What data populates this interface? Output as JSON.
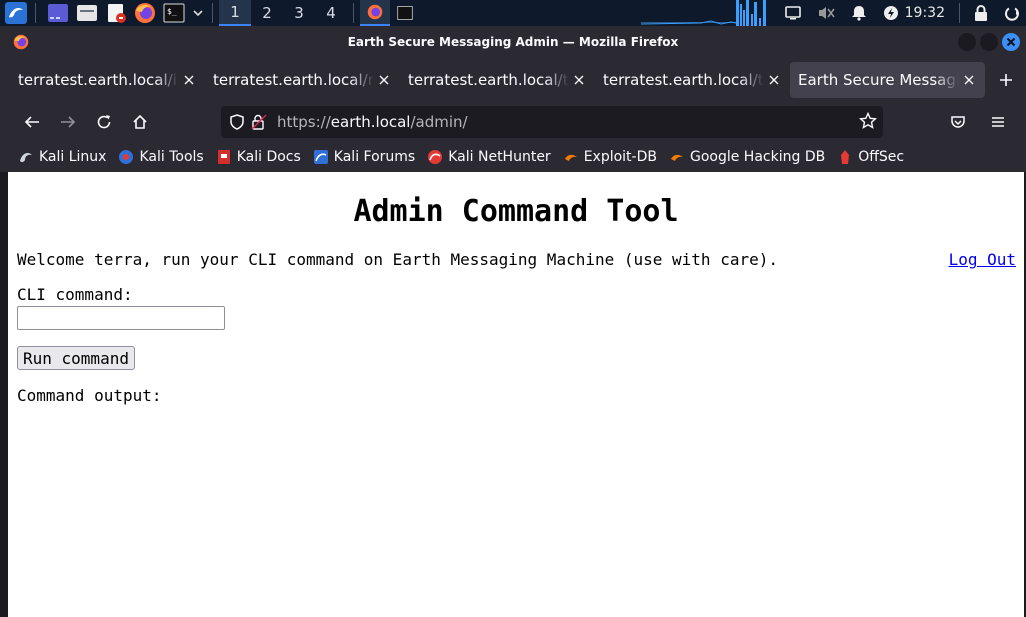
{
  "taskbar": {
    "workspaces": [
      "1",
      "2",
      "3",
      "4"
    ],
    "active_workspace": "1",
    "clock": "19:32",
    "accent": "#3b82f6"
  },
  "window": {
    "title": "Earth Secure Messaging Admin — Mozilla Firefox"
  },
  "tabs": [
    {
      "label": "terratest.earth.local/index",
      "active": false
    },
    {
      "label": "terratest.earth.local/robots",
      "active": false
    },
    {
      "label": "terratest.earth.local/testingnotes",
      "active": false
    },
    {
      "label": "terratest.earth.local/testdata",
      "active": false
    },
    {
      "label": "Earth Secure Messaging Admin",
      "active": true
    }
  ],
  "urlbar": {
    "scheme": "https://",
    "host": "earth.local",
    "path": "/admin/"
  },
  "bookmarks": [
    {
      "label": "Kali Linux",
      "icon": "kali-dragon-icon"
    },
    {
      "label": "Kali Tools",
      "icon": "kali-tools-icon"
    },
    {
      "label": "Kali Docs",
      "icon": "kali-docs-icon"
    },
    {
      "label": "Kali Forums",
      "icon": "kali-forums-icon"
    },
    {
      "label": "Kali NetHunter",
      "icon": "kali-nethunter-icon"
    },
    {
      "label": "Exploit-DB",
      "icon": "exploit-db-icon"
    },
    {
      "label": "Google Hacking DB",
      "icon": "ghdb-icon"
    },
    {
      "label": "OffSec",
      "icon": "offsec-icon"
    }
  ],
  "page": {
    "heading": "Admin Command Tool",
    "welcome": "Welcome terra, run your CLI command on Earth Messaging Machine (use with care).",
    "logout": "Log Out",
    "cli_label": "CLI command:",
    "cli_value": "",
    "run_button": "Run command",
    "output_label": "Command output:"
  }
}
